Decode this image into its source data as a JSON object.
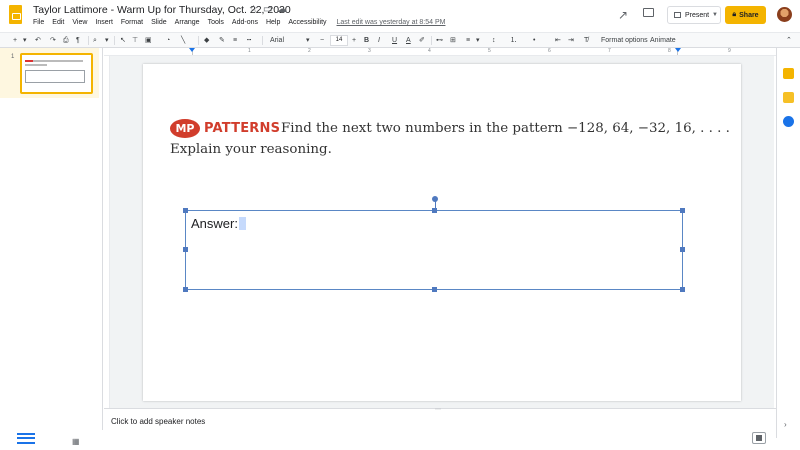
{
  "header": {
    "title": "Taylor Lattimore - Warm Up for Thursday, Oct. 22, 2020",
    "menu": [
      "File",
      "Edit",
      "View",
      "Insert",
      "Format",
      "Slide",
      "Arrange",
      "Tools",
      "Add-ons",
      "Help",
      "Accessibility"
    ],
    "last_edit": "Last edit was yesterday at 8:54 PM",
    "present_label": "Present",
    "share_label": "Share"
  },
  "toolbar": {
    "font": "Arial",
    "font_size": "14",
    "format_options": "Format options",
    "animate": "Animate",
    "bold": "B",
    "italic": "I",
    "underline": "U",
    "text_color": "A"
  },
  "filmstrip": {
    "slide_number": "1"
  },
  "ruler": {
    "numbers": [
      "1",
      "2",
      "3",
      "4",
      "5",
      "6",
      "7",
      "8",
      "9"
    ]
  },
  "slide": {
    "badge": "MP",
    "category": "PATTERNS",
    "problem_line1": "Find the next two numbers in the pattern −128, 64, −32, 16, . . . .",
    "problem_line2": "Explain your reasoning.",
    "answer_text": "Answer:"
  },
  "notes": {
    "placeholder": "Click to add speaker notes"
  },
  "colors": {
    "accent": "#f4b400",
    "selection": "#4f79bf",
    "mp_red": "#d13d2c"
  }
}
